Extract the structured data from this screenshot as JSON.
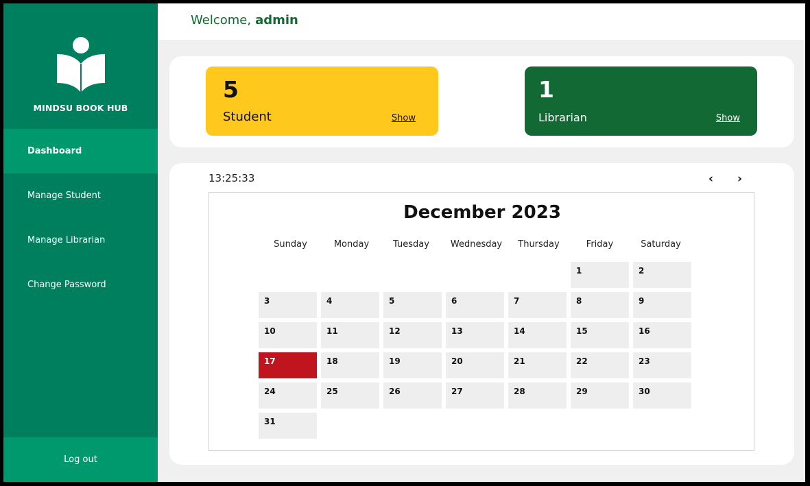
{
  "sidebar": {
    "brand": "MINDSU BOOK HUB",
    "logo_icon": "reading-person-icon",
    "items": [
      {
        "label": "Dashboard",
        "active": true
      },
      {
        "label": "Manage Student"
      },
      {
        "label": "Manage Librarian"
      },
      {
        "label": "Change Password"
      }
    ],
    "logout": "Log out"
  },
  "header": {
    "welcome": "Welcome,",
    "user": "admin"
  },
  "stats": {
    "student": {
      "count": "5",
      "label": "Student",
      "show": "Show"
    },
    "librarian": {
      "count": "1",
      "label": "Librarian",
      "show": "Show"
    }
  },
  "calendar": {
    "clock": "13:25:33",
    "prev": "‹",
    "next": "›",
    "title": "December 2023",
    "weekdays": [
      "Sunday",
      "Monday",
      "Tuesday",
      "Wednesday",
      "Thursday",
      "Friday",
      "Saturday"
    ],
    "days": [
      "1",
      "2",
      "3",
      "4",
      "5",
      "6",
      "7",
      "8",
      "9",
      "10",
      "11",
      "12",
      "13",
      "14",
      "15",
      "16",
      "17",
      "18",
      "19",
      "20",
      "21",
      "22",
      "23",
      "24",
      "25",
      "26",
      "27",
      "28",
      "29",
      "30",
      "31"
    ],
    "today": "17"
  },
  "colors": {
    "sidebar": "#007f5f",
    "sidebar_active": "#00996e",
    "student_card": "#ffc81c",
    "librarian_card": "#126934",
    "today": "#c0141f",
    "welcome_text": "#13692f"
  }
}
